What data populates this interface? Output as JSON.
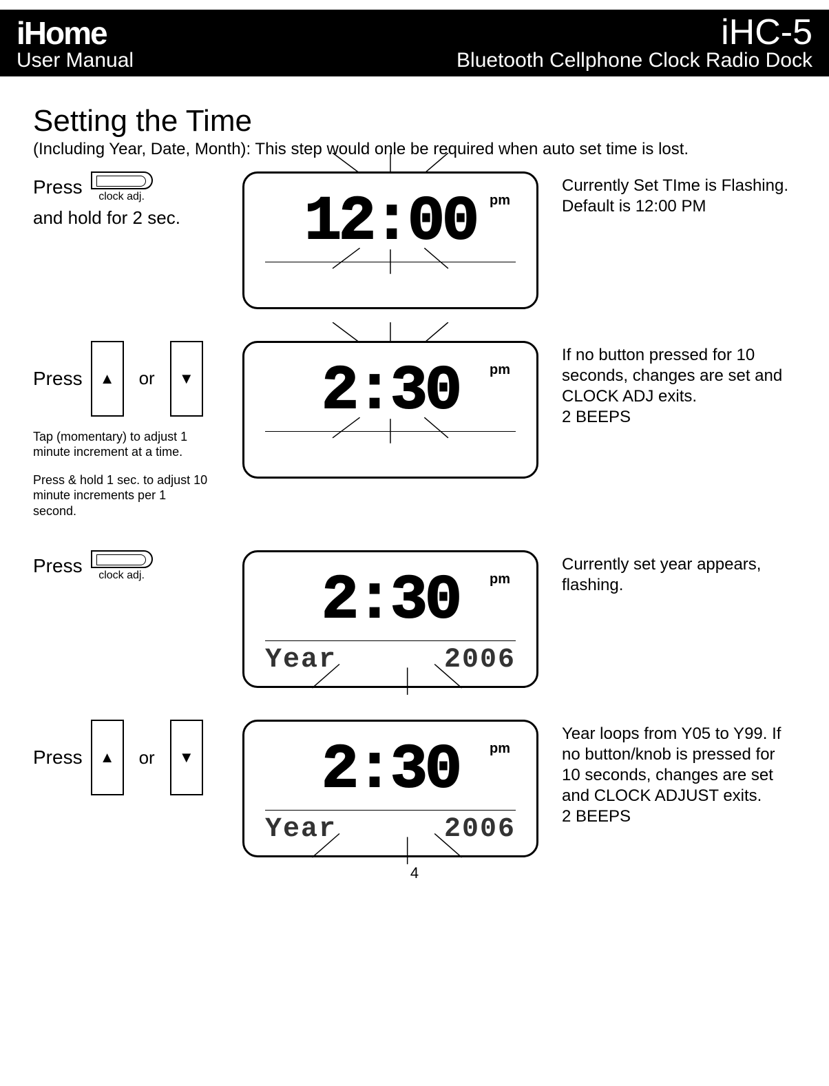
{
  "header": {
    "brand": "iHome",
    "manual_label": "User Manual",
    "model": "iHC-5",
    "product": "Bluetooth Cellphone Clock Radio Dock"
  },
  "section": {
    "title": "Setting the Time",
    "subtitle": "(Including Year, Date, Month):  This step would onle be required when auto set time is lost."
  },
  "labels": {
    "press": "Press",
    "or": "or",
    "hold2sec": "and hold for 2 sec.",
    "clock_adj": "clock adj.",
    "tap_note": "Tap (momentary) to adjust 1 minute increment at a time.",
    "hold_note": "Press & hold 1 sec. to adjust 10 minute increments per 1 second."
  },
  "steps": [
    {
      "lcd": {
        "time": "12:00",
        "ampm": "pm",
        "show_year": false
      },
      "right": "Currently Set TIme is Flashing. Default is 12:00 PM",
      "left_type": "clockadj_hold"
    },
    {
      "lcd": {
        "time": "2:30",
        "ampm": "pm",
        "show_year": false
      },
      "right": "If no button pressed for 10 seconds, changes are set and CLOCK ADJ exits.\n2 BEEPS",
      "left_type": "arrows_notes"
    },
    {
      "lcd": {
        "time": "2:30",
        "ampm": "pm",
        "show_year": true,
        "year_label": "Year",
        "year_value": "2006"
      },
      "right": "Currently set year appears, flashing.",
      "left_type": "clockadj"
    },
    {
      "lcd": {
        "time": "2:30",
        "ampm": "pm",
        "show_year": true,
        "year_label": "Year",
        "year_value": "2006"
      },
      "right": "Year loops from Y05 to Y99. If no button/knob is pressed for 10 seconds, changes are set and CLOCK ADJUST exits.\n2 BEEPS",
      "left_type": "arrows"
    }
  ],
  "page_number": "4"
}
